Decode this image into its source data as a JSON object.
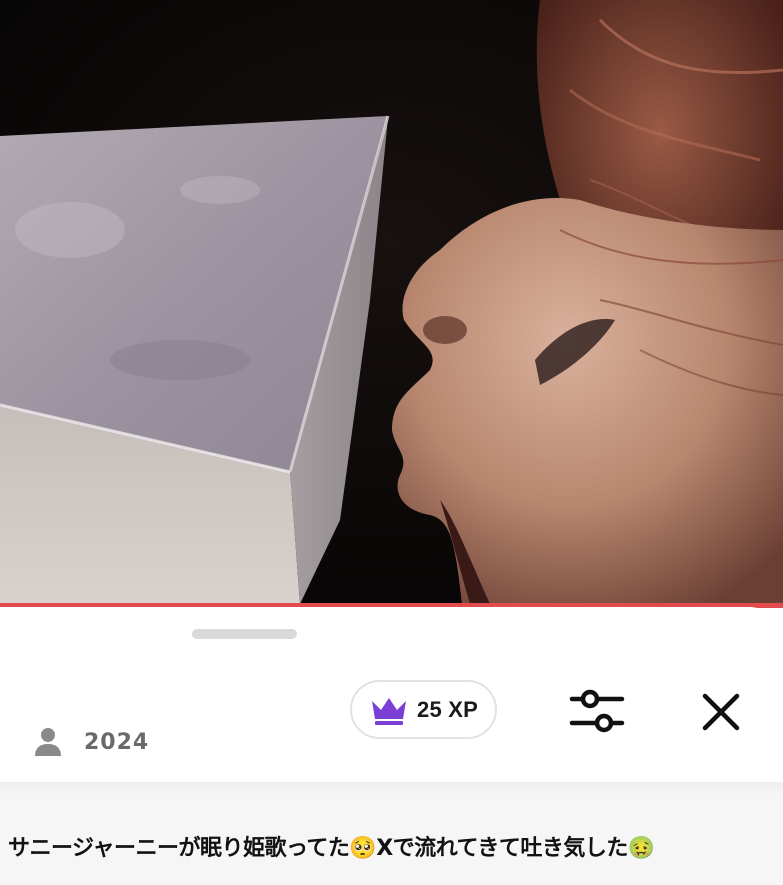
{
  "video": {
    "progress_fraction": 1.0,
    "progress_color": "#e24b4b"
  },
  "sheet": {
    "xp_badge": {
      "label": "25 XP",
      "icon": "crown-icon",
      "icon_color": "#7b3fd6"
    },
    "filter_icon": "sliders-icon",
    "close_icon": "close-icon",
    "author": {
      "icon": "person-icon",
      "year": "2024"
    }
  },
  "caption": {
    "text": "サニージャーニーが眠り姫歌ってた🥺Xで流れてきて吐き気した🤢"
  }
}
